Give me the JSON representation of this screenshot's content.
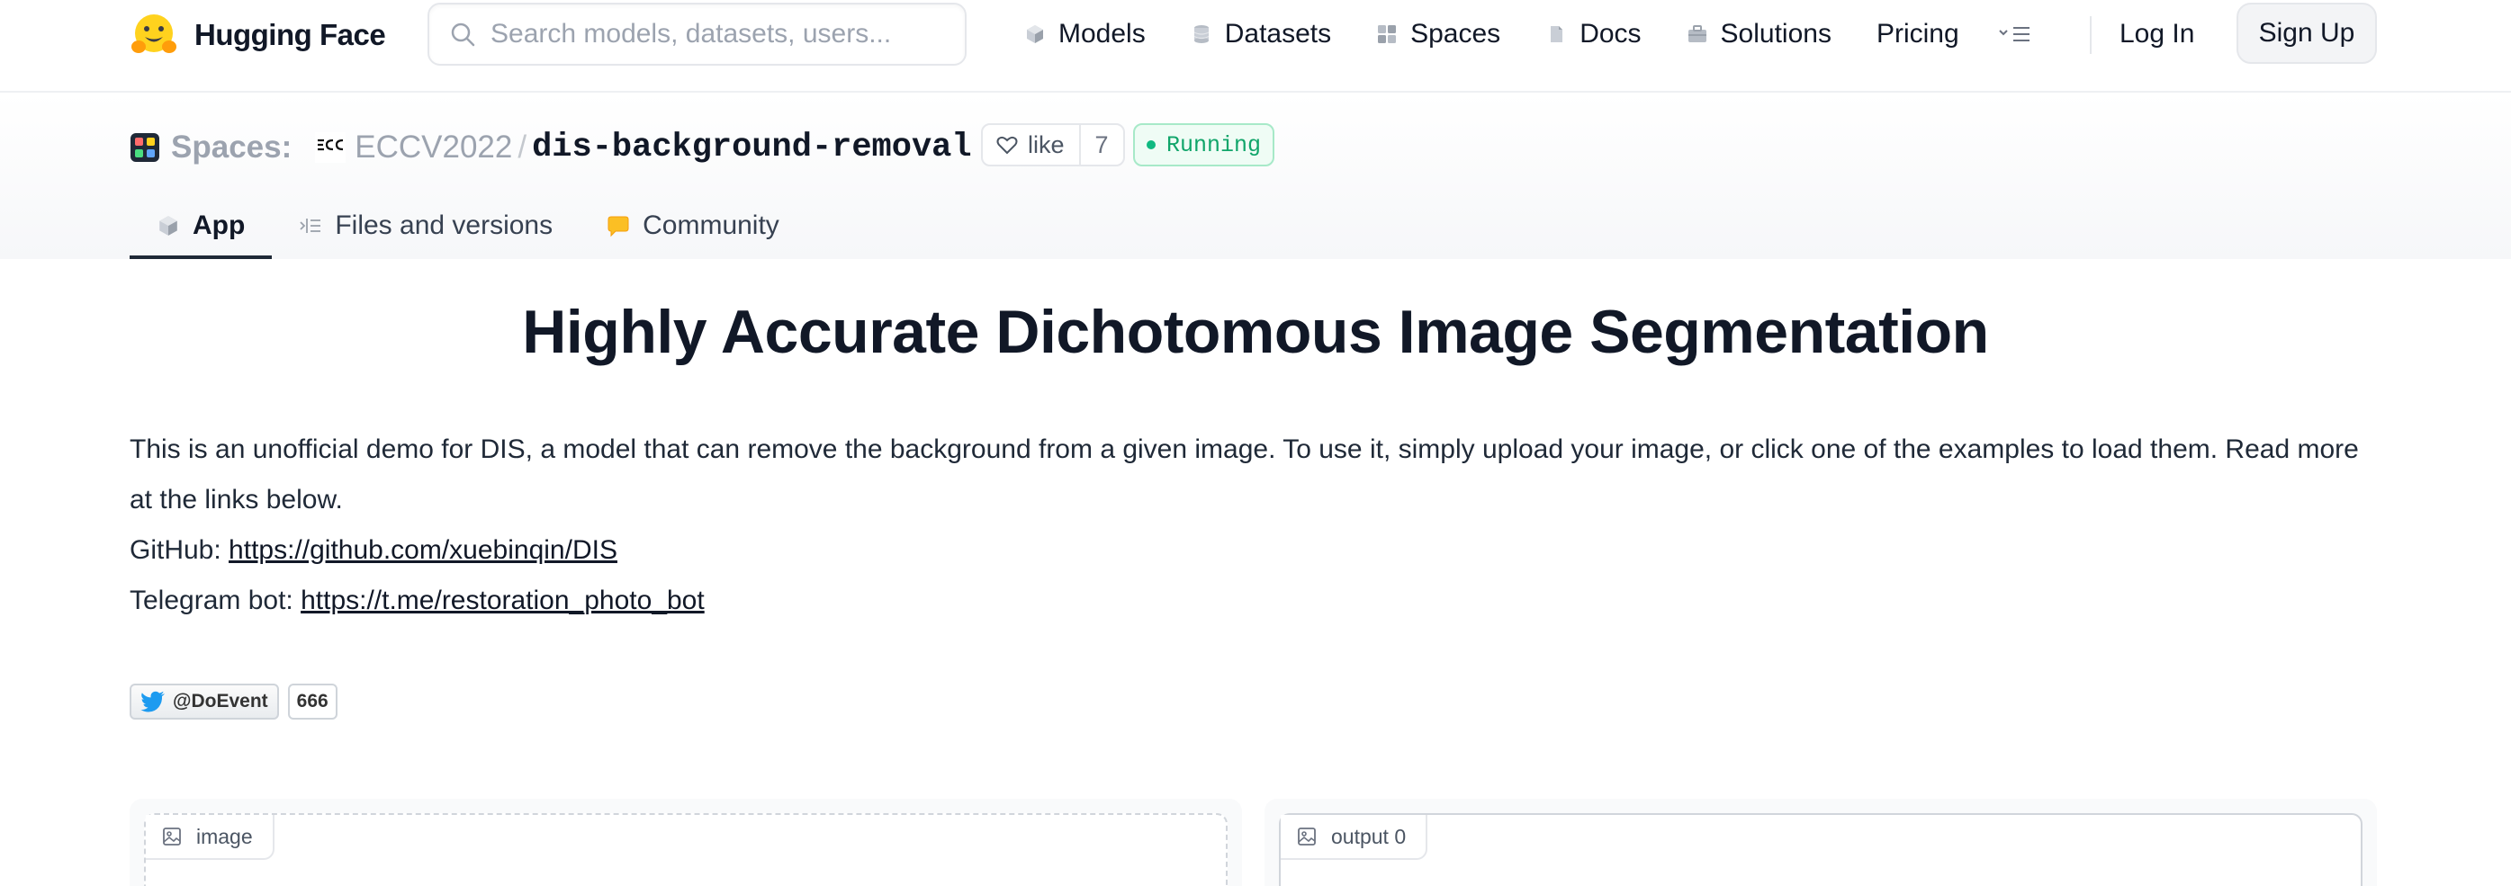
{
  "nav": {
    "logo_text": "Hugging Face",
    "search_placeholder": "Search models, datasets, users...",
    "links": [
      "Models",
      "Datasets",
      "Spaces",
      "Docs",
      "Solutions",
      "Pricing"
    ],
    "login": "Log In",
    "signup": "Sign Up"
  },
  "space": {
    "label": "Spaces:",
    "org": "ECCV2022",
    "separator": "/",
    "repo": "dis-background-removal",
    "like_label": "like",
    "like_count": "7",
    "status": "Running",
    "tabs": [
      "App",
      "Files and versions",
      "Community"
    ]
  },
  "content": {
    "title": "Highly Accurate Dichotomous Image Segmentation",
    "description": "This is an unofficial demo for DIS, a model that can remove the background from a given image. To use it, simply upload your image, or click one of the examples to load them. Read more at the links below.",
    "github_label": "GitHub: ",
    "github_url": "https://github.com/xuebinqin/DIS",
    "telegram_label": "Telegram bot: ",
    "telegram_url": "https://t.me/restoration_photo_bot",
    "twitter_handle": "@DoEvent",
    "twitter_count": "666",
    "input_label": "image",
    "output_label": "output 0"
  },
  "colors": {
    "running_green": "#10a56a",
    "twitter_blue": "#1d9bf0",
    "logo_yellow": "#ffd21e"
  }
}
